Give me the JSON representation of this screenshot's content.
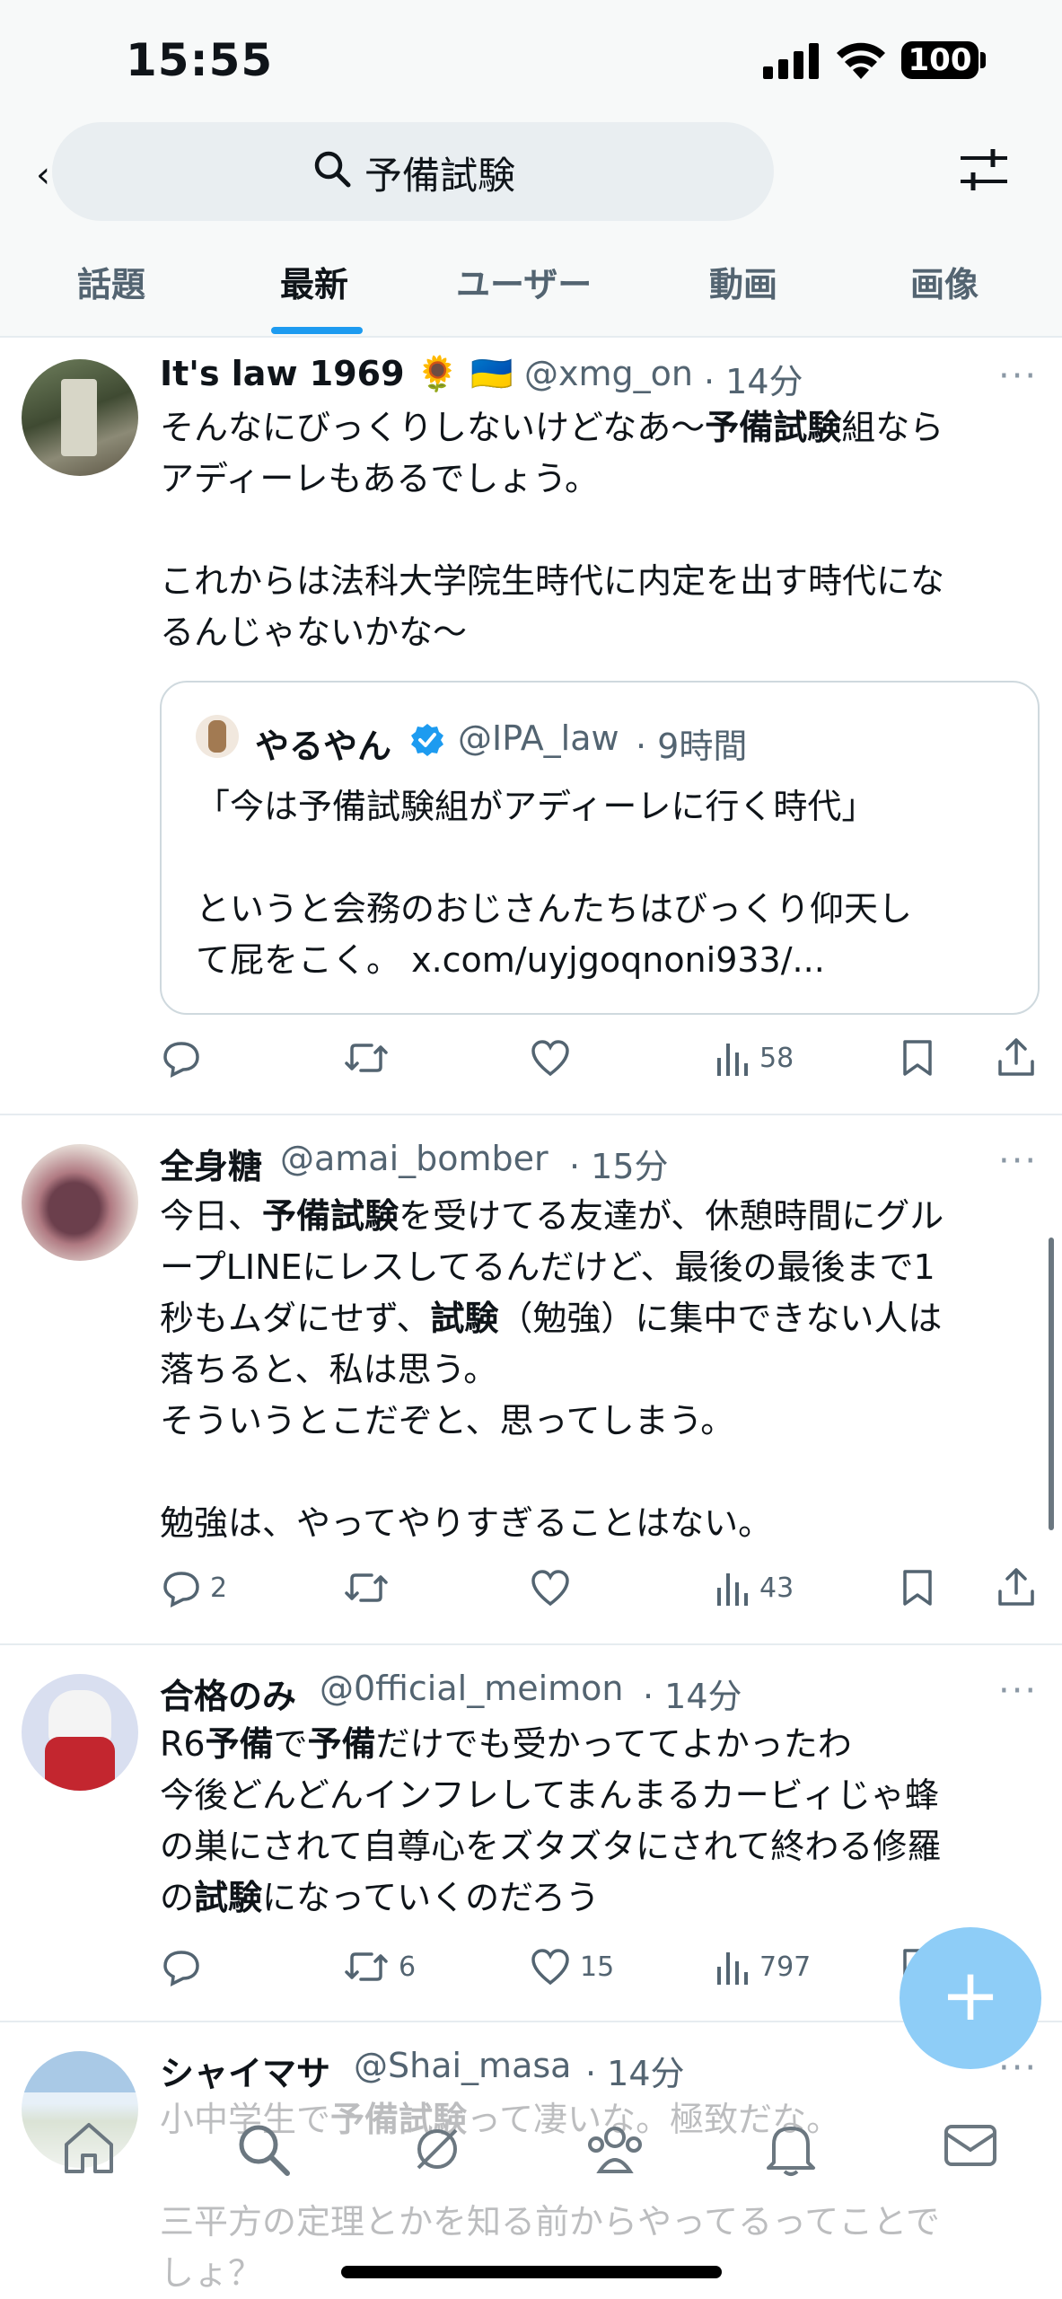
{
  "status_bar": {
    "time": "15:55",
    "battery": "100"
  },
  "search": {
    "query": "予備試験",
    "icon": "search-icon",
    "filter_icon": "filter-sliders-icon"
  },
  "tabs": [
    {
      "label": "話題"
    },
    {
      "label": "最新"
    },
    {
      "label": "ユーザー"
    },
    {
      "label": "動画"
    },
    {
      "label": "画像"
    }
  ],
  "active_tab": "最新",
  "tweets": [
    {
      "name": "It's law 1969 🌻 🇺🇦",
      "handle": "@xmg_on",
      "time": "· 14分",
      "body_html": "そんなにびっくりしないけどなあ〜<b>予備試験</b>組なら\nアディーレもあるでしょう。\n\nこれからは法科大学院生時代に内定を出す時代にな\nるんじゃないかな〜",
      "quote": {
        "name": "やるやん",
        "handle": "@IPA_law",
        "time": "· 9時間",
        "body": "「今は予備試験組がアディーレに行く時代」\n\nというと会務のおじさんたちはびっくり仰天し\nて屁をこく。 x.com/uyjgoqnoni933/..."
      },
      "replies": "",
      "retweets": "",
      "likes": "",
      "views": "58"
    },
    {
      "name": "全身糖",
      "handle": "@amai_bomber",
      "time": "· 15分",
      "body_html": "今日、<b>予備試験</b>を受けてる友達が、休憩時間にグル\nープLINEにレスしてるんだけど、最後の最後まで1\n秒もムダにせず、<b>試験</b>（勉強）に集中できない人は\n落ちると、私は思う。\nそういうとこだぞと、思ってしまう。\n\n勉強は、やってやりすぎることはない。",
      "replies": "2",
      "retweets": "",
      "likes": "",
      "views": "43"
    },
    {
      "name": "合格のみ",
      "handle": "@0fficial_meimon",
      "time": "· 14分",
      "body_html": "R6<b>予備</b>で<b>予備</b>だけでも受かっててよかったわ\n今後どんどんインフレしてまんまるカービィじゃ蜂\nの巣にされて自尊心をズタズタにされて終わる修羅\nの<b>試験</b>になっていくのだろう",
      "replies": "",
      "retweets": "6",
      "likes": "15",
      "views": "797"
    },
    {
      "name": "シャイマサ",
      "handle": "@Shai_masa",
      "time": "· 14分",
      "body_html": "小中学生で<b>予備試験</b>って凄いな。極致だな。\n\n三平方の定理とかを知る前からやってるってことで\nしょ？"
    }
  ],
  "fab": {
    "label": "+"
  },
  "bottom_nav": [
    "home-icon",
    "search-icon",
    "grok-icon",
    "communities-icon",
    "notifications-icon",
    "messages-icon"
  ],
  "colors": {
    "accent": "#1d9bf0",
    "text": "#0f1419",
    "muted": "#536471",
    "fab": "#8ecdf7",
    "verified": "#1d9bf0"
  }
}
